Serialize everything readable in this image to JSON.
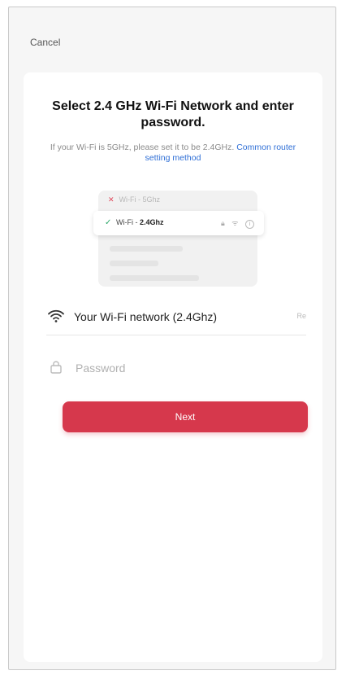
{
  "header": {
    "cancel_label": "Cancel"
  },
  "card": {
    "title": "Select 2.4 GHz Wi-Fi Network and enter password.",
    "hint_text": "If your Wi-Fi is 5GHz, please set it to be 2.4GHz.",
    "hint_link": "Common router setting method"
  },
  "illustration": {
    "row_5g": "Wi-Fi - 5Ghz",
    "row_24_prefix": "Wi-Fi - ",
    "row_24_band": "2.4Ghz"
  },
  "form": {
    "wifi_value": "Your Wi-Fi network (2.4Ghz)",
    "wifi_more": "Re",
    "password_placeholder": "Password"
  },
  "actions": {
    "next_label": "Next"
  },
  "colors": {
    "accent": "#d6384c",
    "link": "#2f6fd6",
    "check": "#2ea86b",
    "cross": "#e0485b"
  },
  "icons": [
    "wifi-icon",
    "lock-icon",
    "check-icon",
    "close-icon",
    "info-icon"
  ]
}
